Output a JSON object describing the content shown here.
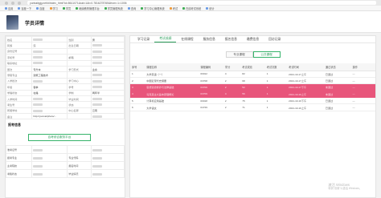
{
  "browser": {
    "url": "yunhaitgjg.net/#/index_html?id=8611071&sid=1&t=0.7816278765&from=1=1006"
  },
  "bookmarks": [
    {
      "label": "应用",
      "color": "#6a9be6"
    },
    {
      "label": "百度一下",
      "color": "#6a9be6"
    },
    {
      "label": "百度",
      "color": "#6a9be6"
    },
    {
      "label": "学习",
      "color": "#f09b3a"
    },
    {
      "label": "学员",
      "color": "#3fae55"
    },
    {
      "label": "继续教育管理平台",
      "color": "#3fae55"
    },
    {
      "label": "学员管理系统",
      "color": "#3fae55"
    },
    {
      "label": "查询",
      "color": "#6a9be6"
    },
    {
      "label": "学习中心管理系统",
      "color": "#3fae55"
    },
    {
      "label": "考试",
      "color": "#f09b3a"
    },
    {
      "label": "在线考试系统",
      "color": "#3fae55"
    },
    {
      "label": "统计",
      "color": "#6a9be6"
    }
  ],
  "header": {
    "title": "学员详情"
  },
  "profile": {
    "rows": [
      [
        "姓名",
        "",
        "性别",
        "男"
      ],
      [
        "民族",
        "汉",
        "出生日期",
        ""
      ],
      [
        "身份证号",
        "",
        "",
        ""
      ],
      [
        "手机号",
        "",
        "邮箱",
        ""
      ],
      [
        "联系地址",
        "",
        "",
        ""
      ],
      [
        "层次",
        "专升本",
        "学习形式",
        "业余"
      ],
      [
        "录取专业",
        "建筑工程技术",
        "",
        ""
      ],
      [
        "入学批次",
        "",
        "学习中心",
        ""
      ],
      [
        "年级",
        "春季",
        "学号",
        ""
      ],
      [
        "学籍状态",
        "在籍",
        "学制",
        "两年半"
      ],
      [
        "入学时间",
        "",
        "毕业时间",
        ""
      ],
      [
        "考生号",
        "",
        "状态",
        ""
      ],
      [
        "所属学校",
        "",
        "中心名称",
        "云南"
      ],
      [
        "备注",
        "http://yuncai/photo/...",
        "",
        ""
      ]
    ]
  },
  "exam": {
    "section_title": "报考信息",
    "button_label": "自考综合服务平台",
    "rows": [
      [
        "准考证号",
        "",
        "",
        ""
      ],
      [
        "报考专业",
        "",
        "专业代码",
        ""
      ],
      [
        "主考院校",
        "",
        "报名时间",
        ""
      ],
      [
        "考籍状态",
        "",
        "毕业情况",
        ""
      ]
    ]
  },
  "tabs": [
    "学习记录",
    "考试成绩",
    "在线课程",
    "服务信息",
    "报名信息",
    "缴费信息",
    "回访记录"
  ],
  "active_tab_index": 1,
  "sub_tabs": [
    "专业课程",
    "公共课程"
  ],
  "active_sub_tab_index": 1,
  "course_table": {
    "headers": [
      "序号",
      "课程名称",
      "课程编码",
      "学分",
      "考试成绩",
      "考试次数",
      "考试时间",
      "通过状态",
      "操作"
    ],
    "rows": [
      {
        "cells": [
          "1",
          "大学英语（一）",
          "00012",
          "4",
          "82",
          "1",
          "2021-10-17上午",
          "已通过",
          "—"
        ],
        "highlight": false
      },
      {
        "cells": [
          "2",
          "中国近现代史纲要",
          "03708",
          "2",
          "68",
          "1",
          "2021-10-17上午",
          "已通过",
          "—"
        ],
        "highlight": false
      },
      {
        "cells": [
          "3",
          "思想道德修养与法律基础",
          "03706",
          "2",
          "52",
          "1",
          "2021-10-17下午",
          "未通过",
          "—"
        ],
        "highlight": true
      },
      {
        "cells": [
          "4",
          "马克思主义基本原理概论",
          "03709",
          "4",
          "56",
          "1",
          "2021-10-16上午",
          "未通过",
          "—"
        ],
        "highlight": true
      },
      {
        "cells": [
          "5",
          "计算机应用基础",
          "00018",
          "2",
          "75",
          "1",
          "2021-10-16下午",
          "已通过",
          "—"
        ],
        "highlight": false
      },
      {
        "cells": [
          "6",
          "大学语文",
          "04729",
          "2",
          "71",
          "1",
          "2021-10-16上午",
          "已通过",
          "—"
        ],
        "highlight": false
      }
    ]
  },
  "watermark": {
    "line1": "激活 Windows",
    "line2": "转到\"设置\"以激活 Windows。"
  }
}
